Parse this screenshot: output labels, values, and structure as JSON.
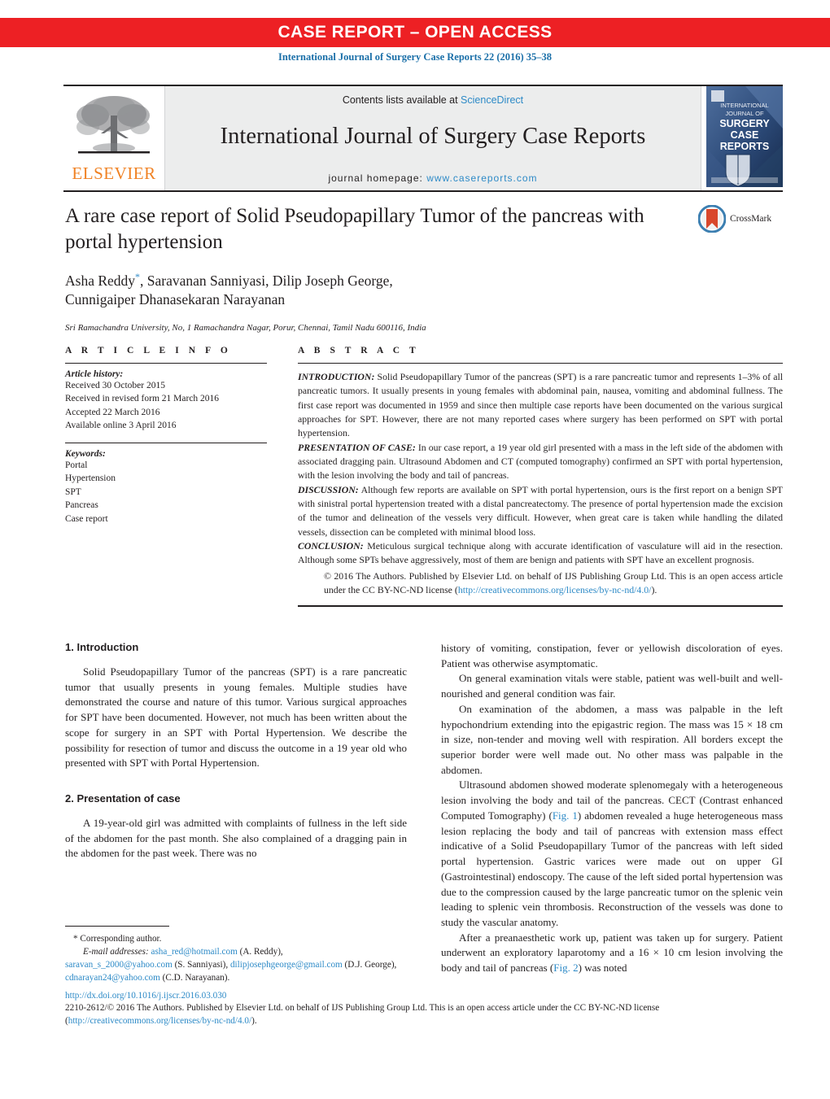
{
  "banner": {
    "text": "CASE REPORT – OPEN ACCESS",
    "bg_color": "#ed2024",
    "text_color": "#ffffff"
  },
  "citation": {
    "text": "International Journal of Surgery Case Reports 22 (2016) 35–38",
    "color": "#1a6fa8"
  },
  "masthead": {
    "elsevier_wordmark": "ELSEVIER",
    "contents_prefix": "Contents lists available at ",
    "contents_link": "ScienceDirect",
    "journal_title": "International Journal of Surgery Case Reports",
    "homepage_prefix": "journal homepage: ",
    "homepage_link": "www.casereports.com",
    "cover_lines": [
      "INTERNATIONAL",
      "JOURNAL OF",
      "SURGERY",
      "CASE",
      "REPORTS"
    ],
    "link_color": "#2d8ac7"
  },
  "article": {
    "title": "A rare case report of Solid Pseudopapillary Tumor of the pancreas with portal hypertension",
    "authors_line1": "Asha Reddy",
    "authors_star": "*",
    "authors_line1_rest": ", Saravanan Sanniyasi, Dilip Joseph George,",
    "authors_line2": "Cunnigaiper Dhanasekaran Narayanan",
    "affiliation": "Sri Ramachandra University, No, 1 Ramachandra Nagar, Porur, Chennai, Tamil Nadu 600116, India",
    "crossmark_label": "CrossMark"
  },
  "article_info": {
    "heading": "A R T I C L E   I N F O",
    "history_label": "Article history:",
    "history": [
      "Received 30 October 2015",
      "Received in revised form 21 March 2016",
      "Accepted 22 March 2016",
      "Available online 3 April 2016"
    ],
    "keywords_label": "Keywords:",
    "keywords": [
      "Portal",
      "Hypertension",
      "SPT",
      "Pancreas",
      "Case report"
    ]
  },
  "abstract": {
    "heading": "A B S T R A C T",
    "sections": [
      {
        "lead": "INTRODUCTION:",
        "text": " Solid Pseudopapillary Tumor of the pancreas (SPT) is a rare pancreatic tumor and represents 1–3% of all pancreatic tumors. It usually presents in young females with abdominal pain, nausea, vomiting and abdominal fullness. The first case report was documented in 1959 and since then multiple case reports have been documented on the various surgical approaches for SPT. However, there are not many reported cases where surgery has been performed on SPT with portal hypertension."
      },
      {
        "lead": "PRESENTATION OF CASE:",
        "text": " In our case report, a 19 year old girl presented with a mass in the left side of the abdomen with associated dragging pain. Ultrasound Abdomen and CT (computed tomography) confirmed an SPT with portal hypertension, with the lesion involving the body and tail of pancreas."
      },
      {
        "lead": "DISCUSSION:",
        "text": " Although few reports are available on SPT with portal hypertension, ours is the first report on a benign SPT with sinistral portal hypertension treated with a distal pancreatectomy. The presence of portal hypertension made the excision of the tumor and delineation of the vessels very difficult. However, when great care is taken while handling the dilated vessels, dissection can be completed with minimal blood loss."
      },
      {
        "lead": "CONCLUSION:",
        "text": " Meticulous surgical technique along with accurate identification of vasculature will aid in the resection. Although some SPTs behave aggressively, most of them are benign and patients with SPT have an excellent prognosis."
      }
    ],
    "copyright_pre": "© 2016 The Authors. Published by Elsevier Ltd. on behalf of IJS Publishing Group Ltd. This is an open access article under the CC BY-NC-ND license (",
    "copyright_link": "http://creativecommons.org/licenses/by-nc-nd/4.0/",
    "copyright_post": ")."
  },
  "body": {
    "left_column": [
      {
        "type": "heading",
        "text": "1.  Introduction"
      },
      {
        "type": "paragraph",
        "text": "Solid Pseudopapillary Tumor of the pancreas (SPT) is a rare pancreatic tumor that usually presents in young females. Multiple studies have demonstrated the course and nature of this tumor. Various surgical approaches for SPT have been documented. However, not much has been written about the scope for surgery in an SPT with Portal Hypertension. We describe the possibility for resection of tumor and discuss the outcome in a 19 year old who presented with SPT with Portal Hypertension."
      },
      {
        "type": "heading",
        "text": "2.  Presentation of case"
      },
      {
        "type": "paragraph",
        "text": "A 19-year-old girl was admitted with complaints of fullness in the left side of the abdomen for the past month. She also complained of a dragging pain in the abdomen for the past week. There was no"
      }
    ],
    "right_column": [
      {
        "type": "paragraph_cont",
        "text": "history of vomiting, constipation, fever or yellowish discoloration of eyes. Patient was otherwise asymptomatic."
      },
      {
        "type": "paragraph",
        "text": "On general examination vitals were stable, patient was well-built and well-nourished and general condition was fair."
      },
      {
        "type": "paragraph",
        "text": "On examination of the abdomen, a mass was palpable in the left hypochondrium extending into the epigastric region. The mass was 15 × 18 cm in size, non-tender and moving well with respiration. All borders except the superior border were well made out. No other mass was palpable in the abdomen."
      },
      {
        "type": "paragraph_fig1",
        "pre": "Ultrasound abdomen showed moderate splenomegaly with a heterogeneous lesion involving the body and tail of the pancreas. CECT (Contrast enhanced Computed Tomography) (",
        "fig": "Fig. 1",
        "post": ") abdomen revealed a huge heterogeneous mass lesion replacing the body and tail of pancreas with extension mass effect indicative of a Solid Pseudopapillary Tumor of the pancreas with left sided portal hypertension. Gastric varices were made out on upper GI (Gastrointestinal) endoscopy. The cause of the left sided portal hypertension was due to the compression caused by the large pancreatic tumor on the splenic vein leading to splenic vein thrombosis. Reconstruction of the vessels was done to study the vascular anatomy."
      },
      {
        "type": "paragraph_fig2",
        "pre": "After a preanaesthetic work up, patient was taken up for surgery. Patient underwent an exploratory laparotomy and a 16 × 10 cm lesion involving the body and tail of pancreas (",
        "fig": "Fig. 2",
        "post": ") was noted"
      }
    ]
  },
  "footnotes": {
    "corresponding": "* Corresponding author.",
    "email_label": "E-mail addresses:",
    "emails": [
      {
        "address": "asha_red@hotmail.com",
        "owner": " (A. Reddy),"
      },
      {
        "address": "saravan_s_2000@yahoo.com",
        "owner": " (S. Sanniyasi), "
      },
      {
        "address": "dilipjosephgeorge@gmail.com",
        "owner": ""
      },
      {
        "address": "cdnarayan24@yahoo.com",
        "owner": " (C.D. Narayanan)."
      }
    ],
    "george_owner": "(D.J. George), "
  },
  "publisher_footer": {
    "doi": "http://dx.doi.org/10.1016/j.ijscr.2016.03.030",
    "issn_copy_pre": "2210-2612/© 2016 The Authors. Published by Elsevier Ltd. on behalf of IJS Publishing Group Ltd. This is an open access article under the CC BY-NC-ND license (",
    "copy_link": "http://creativecommons.org/licenses/by-nc-nd/4.0/",
    "copy_post": ")."
  }
}
